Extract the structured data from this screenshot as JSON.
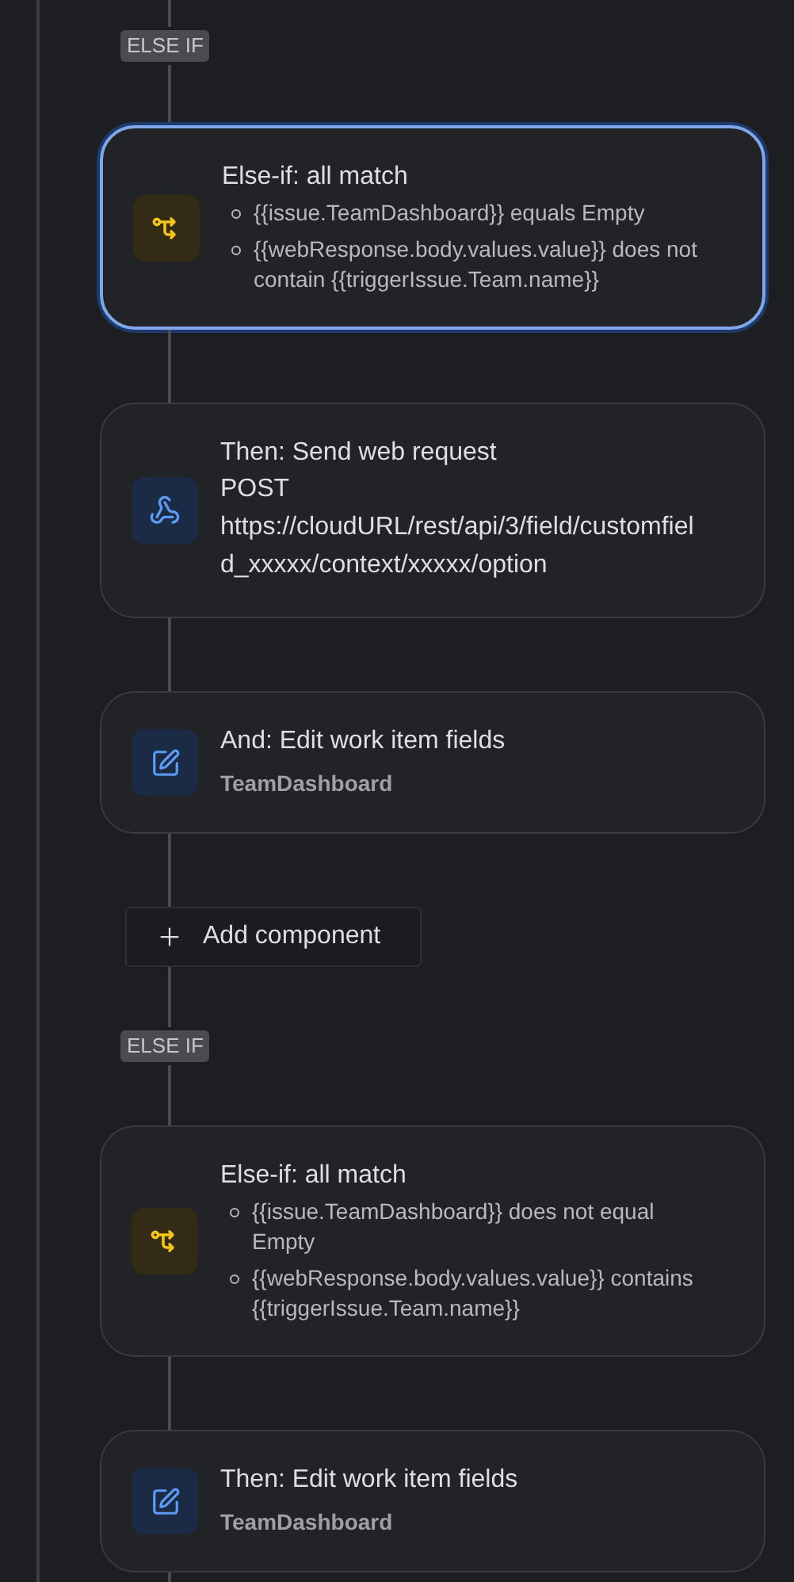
{
  "flow": [
    {
      "kind": "label",
      "text": "ELSE IF"
    },
    {
      "kind": "condition",
      "selected": true,
      "title": "Else-if: all match",
      "conditions": [
        "{{issue.TeamDashboard}} equals Empty",
        "{{webResponse.body.values.value}} does not contain {{triggerIssue.Team.name}}"
      ]
    },
    {
      "kind": "request",
      "selected": false,
      "title": "Then: Send web request",
      "lines": [
        "POST",
        "https://cloudURL/rest/api/3/field/customfield_xxxxx/context/xxxxx/option"
      ]
    },
    {
      "kind": "edit",
      "selected": false,
      "title": "And: Edit work item fields",
      "detail": "TeamDashboard"
    },
    {
      "kind": "add",
      "text": "Add component"
    },
    {
      "kind": "label",
      "text": "ELSE IF"
    },
    {
      "kind": "condition",
      "selected": false,
      "title": "Else-if: all match",
      "conditions": [
        "{{issue.TeamDashboard}} does not equal Empty",
        "{{webResponse.body.values.value}} contains {{triggerIssue.Team.name}}"
      ]
    },
    {
      "kind": "edit",
      "selected": false,
      "title": "Then: Edit work item fields",
      "detail": "TeamDashboard"
    }
  ]
}
